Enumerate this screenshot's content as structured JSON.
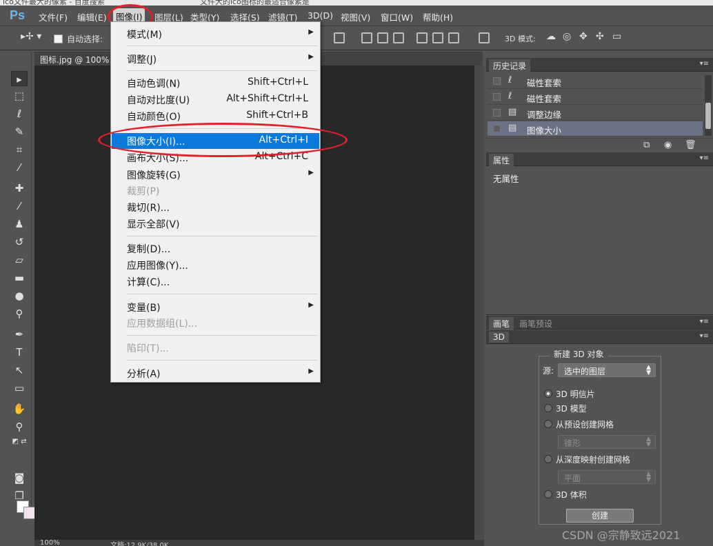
{
  "browser": {
    "tabs": [
      "ico文件最大的像素 - 百度搜索",
      "文件大的ico图标的最适合像素是"
    ]
  },
  "app": {
    "logo": "Ps",
    "menubar": [
      "文件(F)",
      "编辑(E)",
      "图像(I)",
      "图层(L)",
      "类型(Y)",
      "选择(S)",
      "滤镜(T)",
      "3D(D)",
      "视图(V)",
      "窗口(W)",
      "帮助(H)"
    ],
    "active_menu": "图像(I)"
  },
  "options_bar": {
    "auto_select_label": "自动选择:",
    "mode_3d_label": "3D 模式:"
  },
  "document": {
    "tab_title": "图标.jpg @ 100%",
    "zoom": "100%",
    "doc_info": "文档:12.9K/38.0K"
  },
  "image_menu": {
    "items": [
      {
        "label": "模式(M)",
        "shortcut": "",
        "submenu": true,
        "disabled": false
      },
      {
        "label": "调整(J)",
        "shortcut": "",
        "submenu": true,
        "disabled": false
      },
      {
        "label": "自动色调(N)",
        "shortcut": "Shift+Ctrl+L",
        "submenu": false,
        "disabled": false
      },
      {
        "label": "自动对比度(U)",
        "shortcut": "Alt+Shift+Ctrl+L",
        "submenu": false,
        "disabled": false
      },
      {
        "label": "自动颜色(O)",
        "shortcut": "Shift+Ctrl+B",
        "submenu": false,
        "disabled": false
      },
      {
        "label": "图像大小(I)...",
        "shortcut": "Alt+Ctrl+I",
        "submenu": false,
        "disabled": false,
        "highlighted": true
      },
      {
        "label": "画布大小(S)...",
        "shortcut": "Alt+Ctrl+C",
        "submenu": false,
        "disabled": false
      },
      {
        "label": "图像旋转(G)",
        "shortcut": "",
        "submenu": true,
        "disabled": false
      },
      {
        "label": "裁剪(P)",
        "shortcut": "",
        "submenu": false,
        "disabled": true
      },
      {
        "label": "裁切(R)...",
        "shortcut": "",
        "submenu": false,
        "disabled": false
      },
      {
        "label": "显示全部(V)",
        "shortcut": "",
        "submenu": false,
        "disabled": false
      },
      {
        "label": "复制(D)...",
        "shortcut": "",
        "submenu": false,
        "disabled": false
      },
      {
        "label": "应用图像(Y)...",
        "shortcut": "",
        "submenu": false,
        "disabled": false
      },
      {
        "label": "计算(C)...",
        "shortcut": "",
        "submenu": false,
        "disabled": false
      },
      {
        "label": "变量(B)",
        "shortcut": "",
        "submenu": true,
        "disabled": false
      },
      {
        "label": "应用数据组(L)...",
        "shortcut": "",
        "submenu": false,
        "disabled": true
      },
      {
        "label": "陷印(T)...",
        "shortcut": "",
        "submenu": false,
        "disabled": true
      },
      {
        "label": "分析(A)",
        "shortcut": "",
        "submenu": true,
        "disabled": false
      }
    ]
  },
  "history_panel": {
    "tab": "历史记录",
    "rows": [
      {
        "label": "磁性套索",
        "icon": "magnetic-lasso-icon"
      },
      {
        "label": "磁性套索",
        "icon": "magnetic-lasso-icon"
      },
      {
        "label": "调整边缘",
        "icon": "document-icon"
      },
      {
        "label": "图像大小",
        "icon": "document-icon",
        "selected": true
      }
    ]
  },
  "properties_panel": {
    "tab": "属性",
    "empty_text": "无属性"
  },
  "brush_panel": {
    "tabs": [
      "画笔",
      "画笔预设"
    ]
  },
  "panel_3d": {
    "tab": "3D",
    "group_title": "新建 3D 对象",
    "source_label": "源:",
    "source_value": "选中的图层",
    "options": [
      {
        "label": "3D 明信片",
        "checked": true
      },
      {
        "label": "3D 模型",
        "checked": false
      },
      {
        "label": "从预设创建网格",
        "checked": false
      },
      {
        "label": "从深度映射创建网格",
        "checked": false
      },
      {
        "label": "3D 体积",
        "checked": false
      }
    ],
    "preset_value": "锥形",
    "depth_value": "平面",
    "create_button": "创建"
  },
  "watermark": "CSDN @宗静致远2021"
}
